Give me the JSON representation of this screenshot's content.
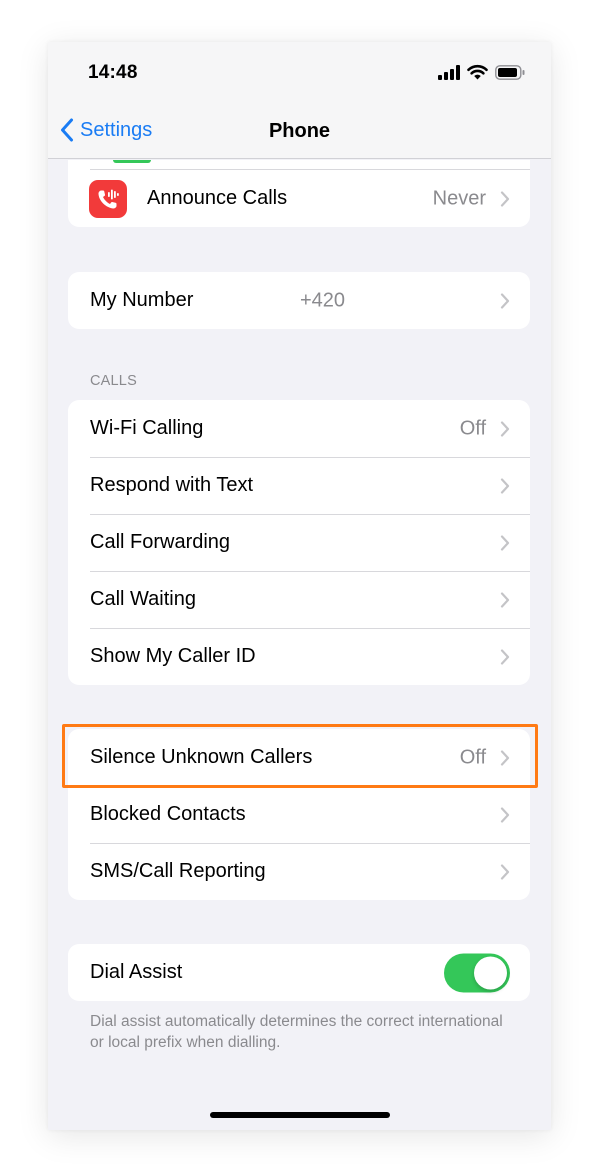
{
  "status_bar": {
    "time": "14:48"
  },
  "nav": {
    "back_label": "Settings",
    "title": "Phone"
  },
  "top_group": {
    "announce_calls": {
      "label": "Announce Calls",
      "value": "Never"
    }
  },
  "my_number": {
    "label": "My Number",
    "value": "+420"
  },
  "calls_section": {
    "header": "CALLS",
    "items": [
      {
        "label": "Wi-Fi Calling",
        "value": "Off"
      },
      {
        "label": "Respond with Text",
        "value": ""
      },
      {
        "label": "Call Forwarding",
        "value": ""
      },
      {
        "label": "Call Waiting",
        "value": ""
      },
      {
        "label": "Show My Caller ID",
        "value": ""
      }
    ]
  },
  "blocking_section": {
    "items": [
      {
        "label": "Silence Unknown Callers",
        "value": "Off"
      },
      {
        "label": "Blocked Contacts",
        "value": ""
      },
      {
        "label": "SMS/Call Reporting",
        "value": ""
      }
    ]
  },
  "dial_assist": {
    "label": "Dial Assist",
    "enabled": true,
    "footer": "Dial assist automatically determines the correct international or local prefix when dialling."
  },
  "colors": {
    "accent": "#1a7cf4",
    "toggle_on": "#34c759",
    "highlight": "#ff7a14",
    "announce_icon_bg": "#f23a3a"
  }
}
